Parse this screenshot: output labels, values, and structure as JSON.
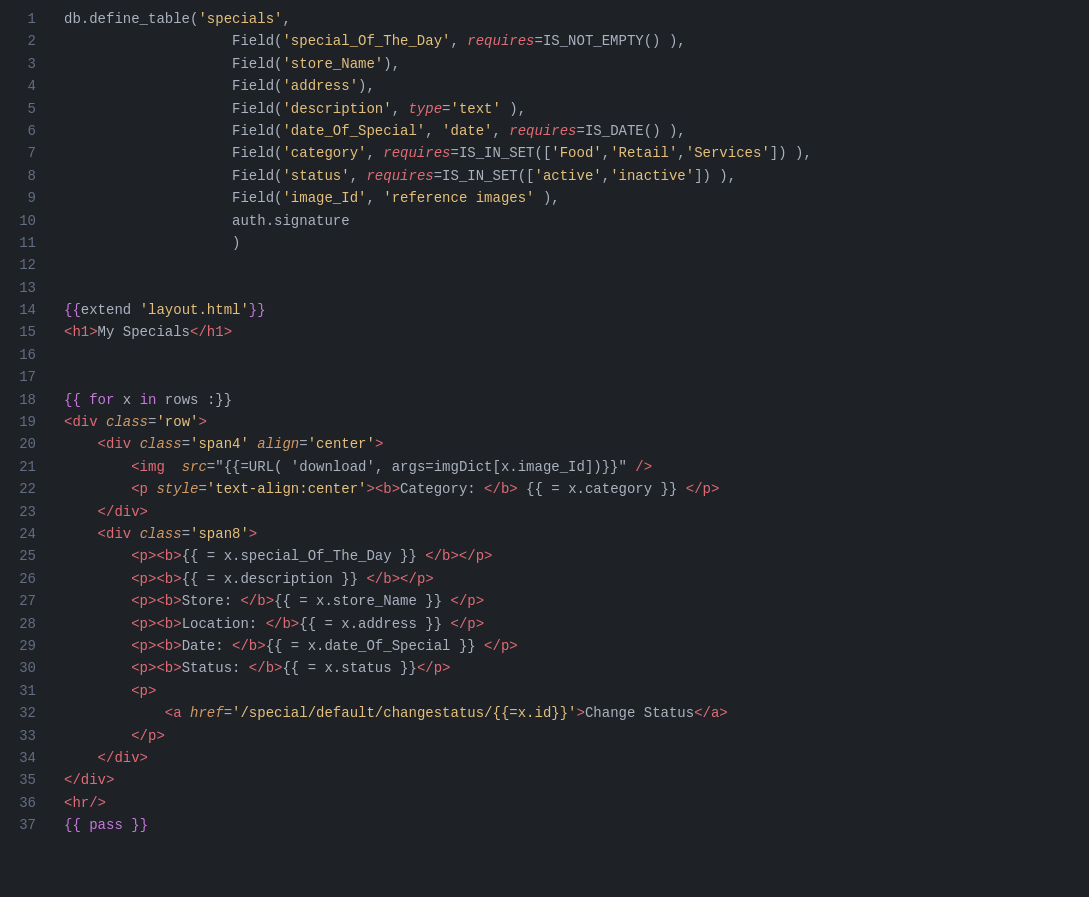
{
  "editor": {
    "background": "#1e2227",
    "lines": [
      {
        "num": 1,
        "tokens": [
          {
            "text": "db.define_table(",
            "cls": "c-white"
          },
          {
            "text": "'specials'",
            "cls": "c-string"
          },
          {
            "text": ",",
            "cls": "c-white"
          }
        ]
      },
      {
        "num": 2,
        "tokens": [
          {
            "text": "                    Field(",
            "cls": "c-white"
          },
          {
            "text": "'special_Of_The_Day'",
            "cls": "c-string"
          },
          {
            "text": ", ",
            "cls": "c-white"
          },
          {
            "text": "requires",
            "cls": "c-italic-red"
          },
          {
            "text": "=IS_NOT_EMPTY() ),",
            "cls": "c-white"
          }
        ]
      },
      {
        "num": 3,
        "tokens": [
          {
            "text": "                    Field(",
            "cls": "c-white"
          },
          {
            "text": "'store_Name'",
            "cls": "c-string"
          },
          {
            "text": "),",
            "cls": "c-white"
          }
        ]
      },
      {
        "num": 4,
        "tokens": [
          {
            "text": "                    Field(",
            "cls": "c-white"
          },
          {
            "text": "'address'",
            "cls": "c-string"
          },
          {
            "text": "),",
            "cls": "c-white"
          }
        ]
      },
      {
        "num": 5,
        "tokens": [
          {
            "text": "                    Field(",
            "cls": "c-white"
          },
          {
            "text": "'description'",
            "cls": "c-string"
          },
          {
            "text": ", ",
            "cls": "c-white"
          },
          {
            "text": "type",
            "cls": "c-italic-red"
          },
          {
            "text": "=",
            "cls": "c-white"
          },
          {
            "text": "'text'",
            "cls": "c-string"
          },
          {
            "text": " ),",
            "cls": "c-white"
          }
        ]
      },
      {
        "num": 6,
        "tokens": [
          {
            "text": "                    Field(",
            "cls": "c-white"
          },
          {
            "text": "'date_Of_Special'",
            "cls": "c-string"
          },
          {
            "text": ", ",
            "cls": "c-white"
          },
          {
            "text": "'date'",
            "cls": "c-string"
          },
          {
            "text": ", ",
            "cls": "c-white"
          },
          {
            "text": "requires",
            "cls": "c-italic-red"
          },
          {
            "text": "=IS_DATE() ),",
            "cls": "c-white"
          }
        ]
      },
      {
        "num": 7,
        "tokens": [
          {
            "text": "                    Field(",
            "cls": "c-white"
          },
          {
            "text": "'category'",
            "cls": "c-string"
          },
          {
            "text": ", ",
            "cls": "c-white"
          },
          {
            "text": "requires",
            "cls": "c-italic-red"
          },
          {
            "text": "=IS_IN_SET([",
            "cls": "c-white"
          },
          {
            "text": "'Food'",
            "cls": "c-string"
          },
          {
            "text": ",",
            "cls": "c-white"
          },
          {
            "text": "'Retail'",
            "cls": "c-string"
          },
          {
            "text": ",",
            "cls": "c-white"
          },
          {
            "text": "'Services'",
            "cls": "c-string"
          },
          {
            "text": "]) ),",
            "cls": "c-white"
          }
        ]
      },
      {
        "num": 8,
        "tokens": [
          {
            "text": "                    Field(",
            "cls": "c-white"
          },
          {
            "text": "'status'",
            "cls": "c-string"
          },
          {
            "text": ", ",
            "cls": "c-white"
          },
          {
            "text": "requires",
            "cls": "c-italic-red"
          },
          {
            "text": "=IS_IN_SET([",
            "cls": "c-white"
          },
          {
            "text": "'active'",
            "cls": "c-string"
          },
          {
            "text": ",",
            "cls": "c-white"
          },
          {
            "text": "'inactive'",
            "cls": "c-string"
          },
          {
            "text": "]) ),",
            "cls": "c-white"
          }
        ]
      },
      {
        "num": 9,
        "tokens": [
          {
            "text": "                    Field(",
            "cls": "c-white"
          },
          {
            "text": "'image_Id'",
            "cls": "c-string"
          },
          {
            "text": ", ",
            "cls": "c-white"
          },
          {
            "text": "'reference images'",
            "cls": "c-string"
          },
          {
            "text": " ),",
            "cls": "c-white"
          }
        ]
      },
      {
        "num": 10,
        "tokens": [
          {
            "text": "                    auth.signature",
            "cls": "c-white"
          }
        ]
      },
      {
        "num": 11,
        "tokens": [
          {
            "text": "                    )",
            "cls": "c-white"
          }
        ]
      },
      {
        "num": 12,
        "tokens": []
      },
      {
        "num": 13,
        "tokens": []
      },
      {
        "num": 14,
        "tokens": [
          {
            "text": "{{",
            "cls": "c-template"
          },
          {
            "text": "extend ",
            "cls": "c-white"
          },
          {
            "text": "'layout.html'",
            "cls": "c-string"
          },
          {
            "text": "}}",
            "cls": "c-template"
          }
        ]
      },
      {
        "num": 15,
        "tokens": [
          {
            "text": "<h1>",
            "cls": "c-red"
          },
          {
            "text": "My Specials",
            "cls": "c-white"
          },
          {
            "text": "</h1>",
            "cls": "c-red"
          }
        ]
      },
      {
        "num": 16,
        "tokens": []
      },
      {
        "num": 17,
        "tokens": []
      },
      {
        "num": 18,
        "tokens": [
          {
            "text": "{{ ",
            "cls": "c-template"
          },
          {
            "text": "for",
            "cls": "c-for"
          },
          {
            "text": " x ",
            "cls": "c-white"
          },
          {
            "text": "in",
            "cls": "c-in"
          },
          {
            "text": " rows :}}",
            "cls": "c-white"
          }
        ]
      },
      {
        "num": 19,
        "tokens": [
          {
            "text": "<div ",
            "cls": "c-red"
          },
          {
            "text": "class",
            "cls": "c-attr"
          },
          {
            "text": "=",
            "cls": "c-white"
          },
          {
            "text": "'row'",
            "cls": "c-attr-val"
          },
          {
            "text": ">",
            "cls": "c-red"
          }
        ]
      },
      {
        "num": 20,
        "tokens": [
          {
            "text": "    <div ",
            "cls": "c-red"
          },
          {
            "text": "class",
            "cls": "c-attr"
          },
          {
            "text": "=",
            "cls": "c-white"
          },
          {
            "text": "'span4'",
            "cls": "c-attr-val"
          },
          {
            "text": " ",
            "cls": "c-white"
          },
          {
            "text": "align",
            "cls": "c-attr"
          },
          {
            "text": "=",
            "cls": "c-white"
          },
          {
            "text": "'center'",
            "cls": "c-attr-val"
          },
          {
            "text": ">",
            "cls": "c-red"
          }
        ]
      },
      {
        "num": 21,
        "tokens": [
          {
            "text": "        <img  ",
            "cls": "c-red"
          },
          {
            "text": "src",
            "cls": "c-attr"
          },
          {
            "text": "=\"{{",
            "cls": "c-white"
          },
          {
            "text": "=URL( 'download', args=imgDict[x.image_Id])",
            "cls": "c-white"
          },
          {
            "text": "}}\"",
            "cls": "c-white"
          },
          {
            "text": " />",
            "cls": "c-red"
          }
        ]
      },
      {
        "num": 22,
        "tokens": [
          {
            "text": "        <p ",
            "cls": "c-red"
          },
          {
            "text": "style",
            "cls": "c-attr"
          },
          {
            "text": "=",
            "cls": "c-white"
          },
          {
            "text": "'text-align:center'",
            "cls": "c-attr-val"
          },
          {
            "text": "><b>",
            "cls": "c-red"
          },
          {
            "text": "Category: ",
            "cls": "c-white"
          },
          {
            "text": "</b>",
            "cls": "c-red"
          },
          {
            "text": " {{ = x.category }} ",
            "cls": "c-white"
          },
          {
            "text": "</p>",
            "cls": "c-red"
          }
        ]
      },
      {
        "num": 23,
        "tokens": [
          {
            "text": "    </div>",
            "cls": "c-red"
          }
        ]
      },
      {
        "num": 24,
        "tokens": [
          {
            "text": "    <div ",
            "cls": "c-red"
          },
          {
            "text": "class",
            "cls": "c-attr"
          },
          {
            "text": "=",
            "cls": "c-white"
          },
          {
            "text": "'span8'",
            "cls": "c-attr-val"
          },
          {
            "text": ">",
            "cls": "c-red"
          }
        ]
      },
      {
        "num": 25,
        "tokens": [
          {
            "text": "        <p><b>",
            "cls": "c-red"
          },
          {
            "text": "{{ = x.special_Of_The_Day }} ",
            "cls": "c-white"
          },
          {
            "text": "</b></p>",
            "cls": "c-red"
          }
        ]
      },
      {
        "num": 26,
        "tokens": [
          {
            "text": "        <p><b>",
            "cls": "c-red"
          },
          {
            "text": "{{ = x.description }} ",
            "cls": "c-white"
          },
          {
            "text": "</b></p>",
            "cls": "c-red"
          }
        ]
      },
      {
        "num": 27,
        "tokens": [
          {
            "text": "        <p><b>",
            "cls": "c-red"
          },
          {
            "text": "Store: ",
            "cls": "c-white"
          },
          {
            "text": "</b>",
            "cls": "c-red"
          },
          {
            "text": "{{ = x.store_Name }} ",
            "cls": "c-white"
          },
          {
            "text": "</p>",
            "cls": "c-red"
          }
        ]
      },
      {
        "num": 28,
        "tokens": [
          {
            "text": "        <p><b>",
            "cls": "c-red"
          },
          {
            "text": "Location: ",
            "cls": "c-white"
          },
          {
            "text": "</b>",
            "cls": "c-red"
          },
          {
            "text": "{{ = x.address }} ",
            "cls": "c-white"
          },
          {
            "text": "</p>",
            "cls": "c-red"
          }
        ]
      },
      {
        "num": 29,
        "tokens": [
          {
            "text": "        <p><b>",
            "cls": "c-red"
          },
          {
            "text": "Date: ",
            "cls": "c-white"
          },
          {
            "text": "</b>",
            "cls": "c-red"
          },
          {
            "text": "{{ = x.date_Of_Special }} ",
            "cls": "c-white"
          },
          {
            "text": "</p>",
            "cls": "c-red"
          }
        ]
      },
      {
        "num": 30,
        "tokens": [
          {
            "text": "        <p><b>",
            "cls": "c-red"
          },
          {
            "text": "Status: ",
            "cls": "c-white"
          },
          {
            "text": "</b>",
            "cls": "c-red"
          },
          {
            "text": "{{ = x.status }}",
            "cls": "c-white"
          },
          {
            "text": "</p>",
            "cls": "c-red"
          }
        ]
      },
      {
        "num": 31,
        "tokens": [
          {
            "text": "        <p>",
            "cls": "c-red"
          }
        ]
      },
      {
        "num": 32,
        "tokens": [
          {
            "text": "            <a ",
            "cls": "c-red"
          },
          {
            "text": "href",
            "cls": "c-attr"
          },
          {
            "text": "=",
            "cls": "c-white"
          },
          {
            "text": "'/special/default/changestatus/{{=x.id}}'",
            "cls": "c-attr-val"
          },
          {
            "text": ">",
            "cls": "c-red"
          },
          {
            "text": "Change Status",
            "cls": "c-white"
          },
          {
            "text": "</a>",
            "cls": "c-red"
          }
        ]
      },
      {
        "num": 33,
        "tokens": [
          {
            "text": "        </p>",
            "cls": "c-red"
          }
        ]
      },
      {
        "num": 34,
        "tokens": [
          {
            "text": "    </div>",
            "cls": "c-red"
          }
        ]
      },
      {
        "num": 35,
        "tokens": [
          {
            "text": "</div>",
            "cls": "c-red"
          }
        ]
      },
      {
        "num": 36,
        "tokens": [
          {
            "text": "<hr/>",
            "cls": "c-red"
          }
        ]
      },
      {
        "num": 37,
        "tokens": [
          {
            "text": "{{ ",
            "cls": "c-template"
          },
          {
            "text": "pass",
            "cls": "c-for"
          },
          {
            "text": " }}",
            "cls": "c-template"
          }
        ]
      }
    ]
  }
}
